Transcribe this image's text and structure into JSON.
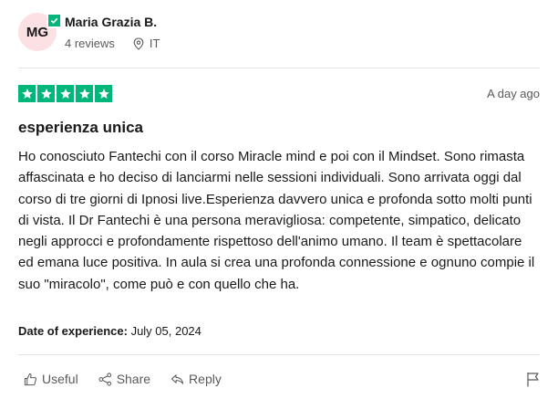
{
  "reviewer": {
    "initials": "MG",
    "name": "Maria Grazia B.",
    "reviews": "4 reviews",
    "country": "IT"
  },
  "review": {
    "rating": 5,
    "date": "A day ago",
    "title": "esperienza unica",
    "body": "Ho conosciuto Fantechi con il corso Miracle mind e poi con il Mindset. Sono rimasta affascinata e ho deciso di lanciarmi nelle sessioni individuali. Sono arrivata oggi dal corso di tre giorni di Ipnosi live.Esperienza davvero unica e profonda sotto molti punti di vista. Il Dr Fantechi è una persona meravigliosa: competente, simpatico, delicato negli approcci e profondamente rispettoso dell'animo umano. Il team è spettacolare ed emana luce positiva. In aula si crea una profonda connessione e ognuno compie il suo \"miracolo\", come può e con quello che ha.",
    "experience_label": "Date of experience:",
    "experience_date": "July 05, 2024"
  },
  "actions": {
    "useful": "Useful",
    "share": "Share",
    "reply": "Reply"
  },
  "colors": {
    "star_green": "#00b67a",
    "avatar_bg": "#fbe0e4",
    "muted_text": "#5a5a5a"
  }
}
